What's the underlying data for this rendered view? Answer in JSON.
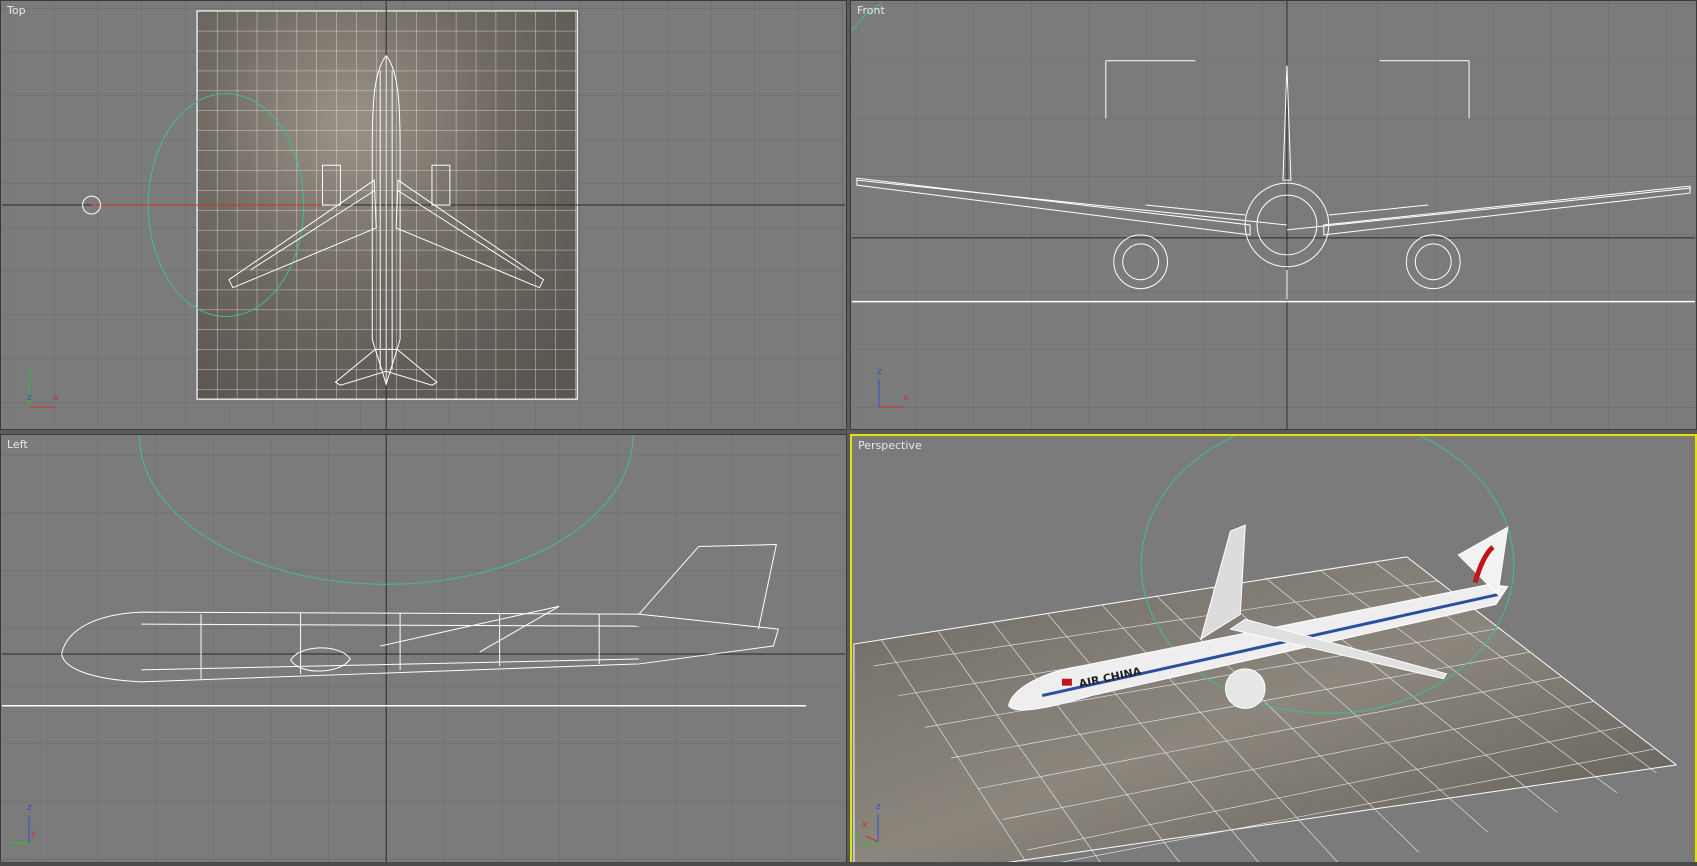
{
  "viewports": {
    "top": {
      "label": "Top",
      "axes": [
        "y",
        "z",
        "x"
      ]
    },
    "front": {
      "label": "Front",
      "axes": [
        "z",
        "x"
      ]
    },
    "left": {
      "label": "Left",
      "axes": [
        "z",
        "y"
      ]
    },
    "persp": {
      "label": "Perspective",
      "axes": [
        "z",
        "y",
        "x"
      ],
      "active": true,
      "livery": "AIR CHINA"
    }
  },
  "colors": {
    "viewport_bg": "#7b7b7b",
    "grid": "#6a6a6a",
    "world_axis": "#2a2a2a",
    "wireframe": "#ffffff",
    "light_range": "#3fbf8f",
    "active_border": "#e6e200"
  }
}
